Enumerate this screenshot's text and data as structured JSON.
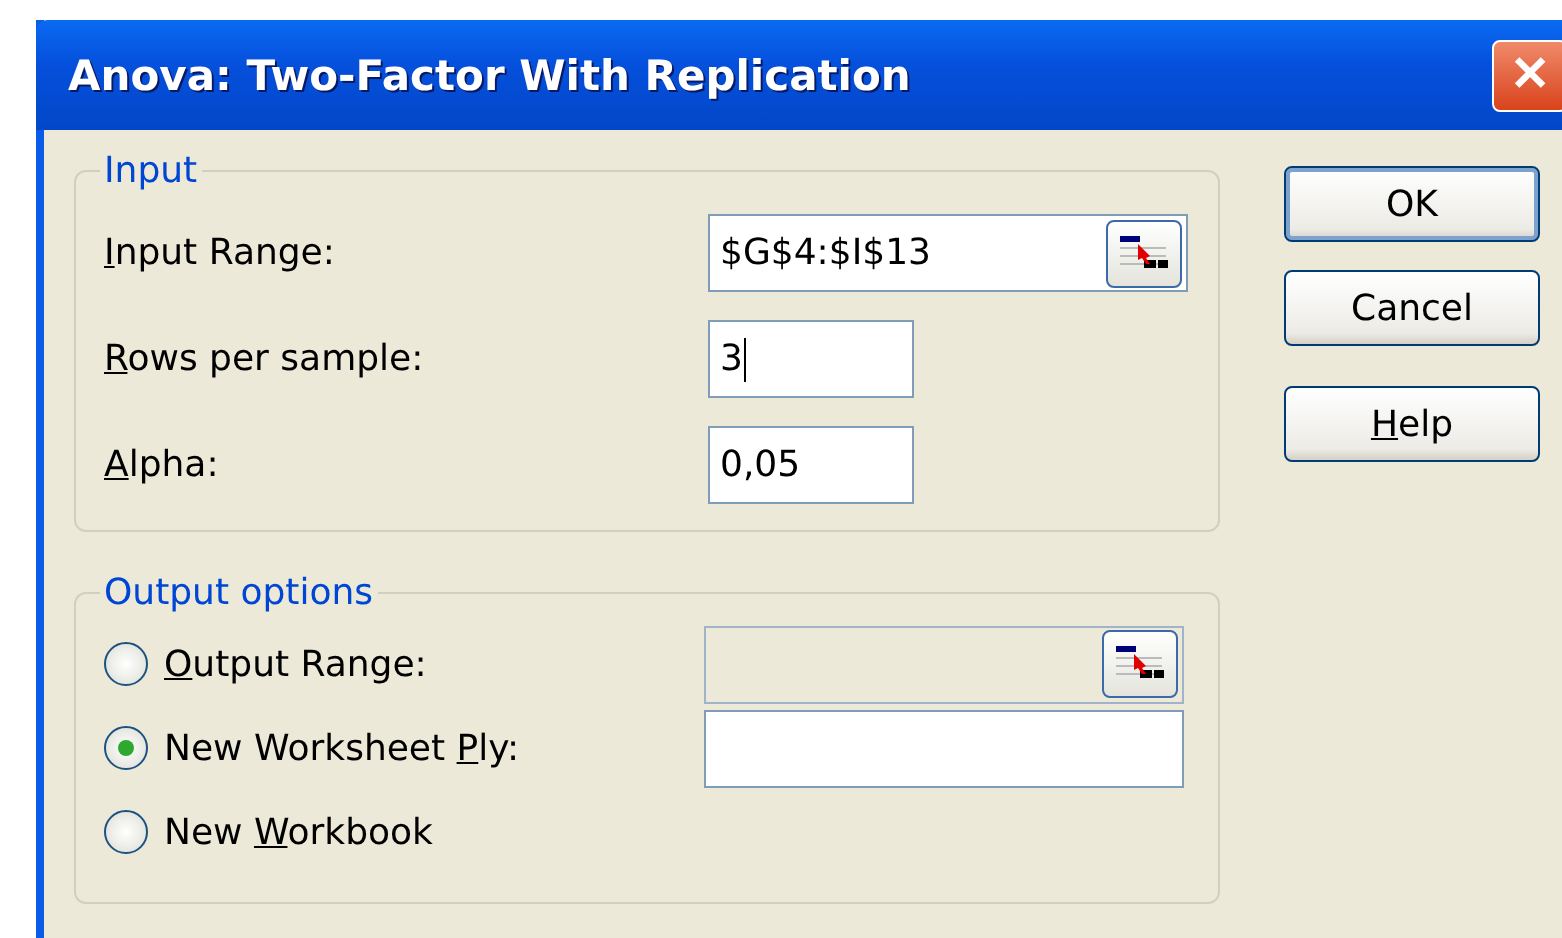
{
  "window": {
    "title": "Anova: Two-Factor With Replication",
    "close_glyph": "✕"
  },
  "input": {
    "legend": "Input",
    "fields": [
      {
        "label": {
          "key": "I",
          "after": "nput Range:"
        },
        "value": "$G$4:$I$13",
        "kind": "range",
        "caret": false
      },
      {
        "label": {
          "key": "R",
          "after": "ows per sample:"
        },
        "value": "3",
        "kind": "short",
        "caret": true
      },
      {
        "label": {
          "key": "A",
          "after": "lpha:"
        },
        "value": "0,05",
        "kind": "short",
        "caret": false
      }
    ]
  },
  "output": {
    "legend": "Output options",
    "options": [
      {
        "label": {
          "key": "O",
          "after": "utput Range:"
        },
        "selected": false,
        "field": {
          "kind": "range",
          "disabled": true
        }
      },
      {
        "label": {
          "before": "New Worksheet ",
          "key": "P",
          "after": "ly:"
        },
        "selected": true,
        "field": {
          "kind": "text",
          "disabled": false
        }
      },
      {
        "label": {
          "before": "New ",
          "key": "W",
          "after": "orkbook"
        },
        "selected": false
      }
    ]
  },
  "buttons": [
    {
      "label": {
        "before": "OK"
      },
      "default": true
    },
    {
      "label": {
        "before": "Cancel"
      },
      "default": false
    },
    {
      "label": {
        "key": "H",
        "after": "elp"
      },
      "default": false
    }
  ]
}
